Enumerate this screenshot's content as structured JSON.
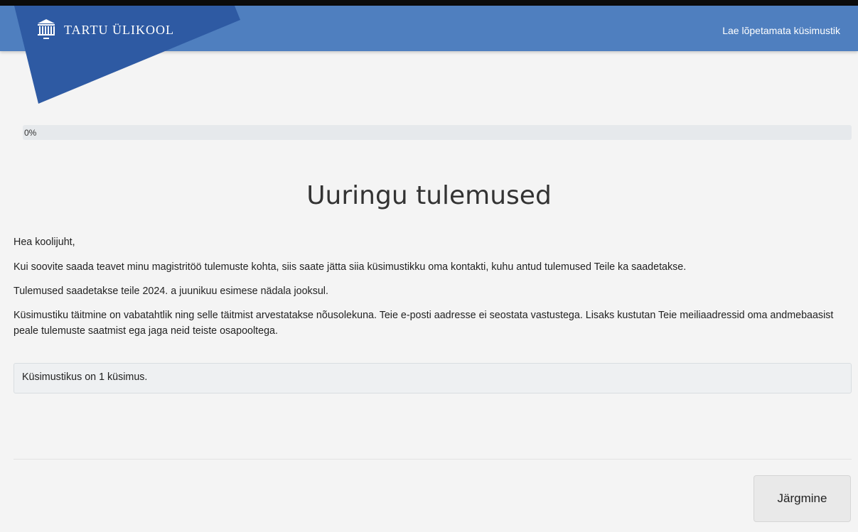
{
  "header": {
    "brand_name": "TARTU ÜLIKOOL",
    "link_label": "Lae lõpetamata küsimustik",
    "color": "#4f7fbf",
    "brand_shape_color": "#2e5aa3",
    "logo_icon": "university-building-icon"
  },
  "progress": {
    "label": "0%",
    "value": 0
  },
  "main": {
    "title": "Uuringu tulemused",
    "paragraphs": [
      "Hea koolijuht,",
      "Kui soovite saada teavet minu magistritöö tulemuste kohta, siis saate jätta siia küsimustikku oma kontakti, kuhu antud tulemused Teile ka saadetakse.",
      "Tulemused saadetakse teile 2024. a juunikuu esimese nädala jooksul.",
      "Küsimustiku täitmine on vabatahtlik ning selle täitmist arvestatakse nõusolekuna. Teie e-posti aadresse ei seostata vastustega. Lisaks kustutan Teie meiliaadressid oma andmebaasist peale tulemuste saatmist ega jaga neid teiste osapooltega."
    ],
    "info_box": "Küsimustikus on 1 küsimus."
  },
  "footer": {
    "next_label": "Järgmine"
  }
}
